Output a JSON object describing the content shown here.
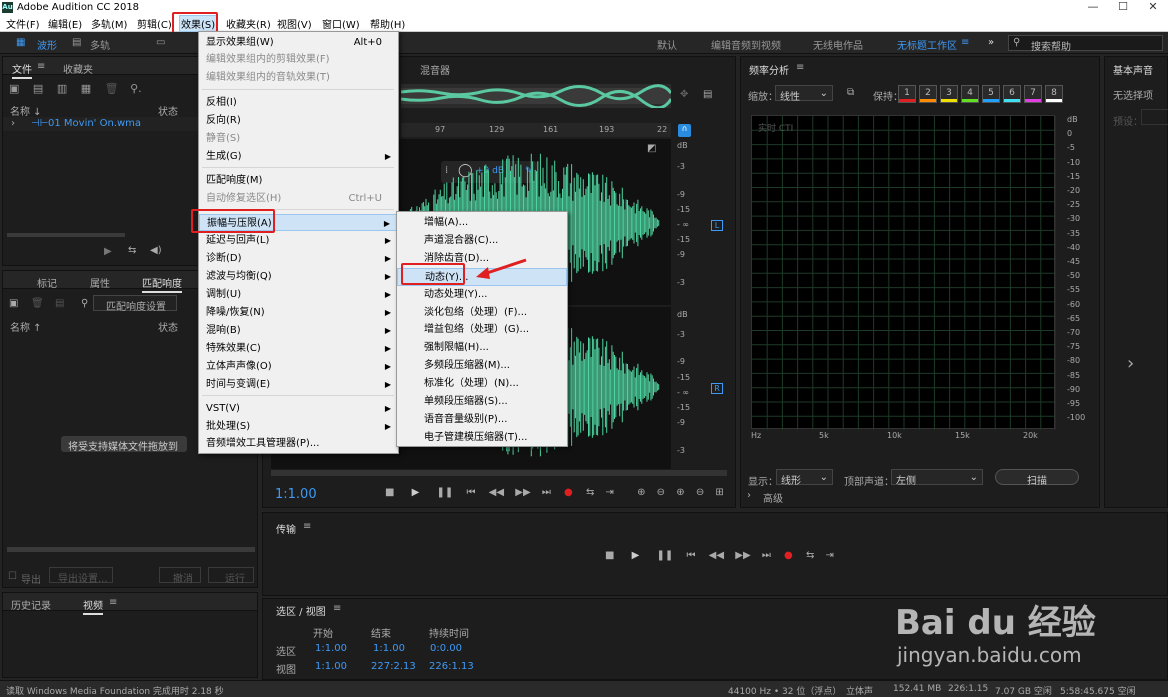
{
  "window": {
    "title": "Adobe Audition CC 2018",
    "logo": "Au"
  },
  "menubar": [
    {
      "label": "文件(F)"
    },
    {
      "label": "编辑(E)"
    },
    {
      "label": "多轨(M)"
    },
    {
      "label": "剪辑(C)"
    },
    {
      "label": "效果(S)"
    },
    {
      "label": "收藏夹(R)"
    },
    {
      "label": "视图(V)"
    },
    {
      "label": "窗口(W)"
    },
    {
      "label": "帮助(H)"
    }
  ],
  "toolbar": {
    "waveform": "波形",
    "multitrack": "多轨",
    "workspaces": [
      "默认",
      "编辑音频到视频",
      "无线电作品",
      "无标题工作区"
    ],
    "more": "»",
    "search_placeholder": "搜索帮助"
  },
  "files_panel": {
    "tabs": [
      "文件",
      "收藏夹"
    ],
    "col_name": "名称 ↓",
    "col_status": "状态",
    "item": "01 Movin' On.wma"
  },
  "markers_panel": {
    "tabs": [
      "标记",
      "属性",
      "匹配响度"
    ],
    "match_settings": "匹配响度设置",
    "col_name": "名称 ↑",
    "col_status": "状态",
    "drop_hint": "将受支持媒体文件拖放到",
    "export": "导出",
    "export_settings": "导出设置...",
    "cancel": "撤消",
    "run": "运行"
  },
  "history_panel": {
    "tabs": [
      "历史记录",
      "视频"
    ]
  },
  "effects_menu": {
    "items": [
      {
        "label": "显示效果组(W)",
        "shortcut": "Alt+0",
        "disabled": false
      },
      {
        "label": "编辑效果组内的剪辑效果(F)",
        "disabled": true
      },
      {
        "label": "编辑效果组内的音轨效果(T)",
        "disabled": true
      },
      {
        "label": "反相(I)",
        "disabled": false
      },
      {
        "label": "反向(R)",
        "disabled": false
      },
      {
        "label": "静音(S)",
        "disabled": true
      },
      {
        "label": "生成(G)",
        "submenu": true
      },
      {
        "label": "匹配响度(M)",
        "disabled": false
      },
      {
        "label": "自动修复选区(H)",
        "shortcut": "Ctrl+U",
        "disabled": true
      },
      {
        "label": "振幅与压限(A)",
        "submenu": true,
        "highlighted": true
      },
      {
        "label": "延迟与回声(L)",
        "submenu": true
      },
      {
        "label": "诊断(D)",
        "submenu": true
      },
      {
        "label": "滤波与均衡(Q)",
        "submenu": true
      },
      {
        "label": "调制(U)",
        "submenu": true
      },
      {
        "label": "降噪/恢复(N)",
        "submenu": true
      },
      {
        "label": "混响(B)",
        "submenu": true
      },
      {
        "label": "特殊效果(C)",
        "submenu": true
      },
      {
        "label": "立体声声像(O)",
        "submenu": true
      },
      {
        "label": "时间与变调(E)",
        "submenu": true
      },
      {
        "label": "VST(V)",
        "submenu": true
      },
      {
        "label": "批处理(S)",
        "submenu": true
      },
      {
        "label": "音频增效工具管理器(P)..."
      }
    ]
  },
  "amplitude_submenu": {
    "items": [
      {
        "label": "增幅(A)..."
      },
      {
        "label": "声道混合器(C)..."
      },
      {
        "label": "消除齿音(D)..."
      },
      {
        "label": "动态(Y)...",
        "highlighted": true
      },
      {
        "label": "动态处理(Y)..."
      },
      {
        "label": "淡化包络（处理）(F)..."
      },
      {
        "label": "增益包络（处理）(G)..."
      },
      {
        "label": "强制限幅(H)..."
      },
      {
        "label": "多频段压缩器(M)..."
      },
      {
        "label": "标准化（处理）(N)..."
      },
      {
        "label": "单频段压缩器(S)..."
      },
      {
        "label": "语音音量级别(P)..."
      },
      {
        "label": "电子管建模压缩器(T)..."
      }
    ]
  },
  "editor": {
    "mixer_tab": "混音器",
    "ruler": [
      "97",
      "129",
      "161",
      "193",
      "22"
    ],
    "hud_db": "+0 dB",
    "db_ticks_top": [
      "dB",
      "-3",
      "-9",
      "-15",
      "- ∞",
      "-15",
      "-9",
      "-3"
    ],
    "db_ticks_bottom": [
      "dB",
      "-3",
      "-9",
      "-15",
      "- ∞",
      "-15",
      "-9",
      "-3"
    ],
    "ch_left": "L",
    "ch_right": "R",
    "time": "1:1.00"
  },
  "freq_panel": {
    "title": "频率分析",
    "scale_label": "缩放：",
    "scale_value": "线性",
    "hold_label": "保持：",
    "hold_slots": [
      "1",
      "2",
      "3",
      "4",
      "5",
      "6",
      "7",
      "8"
    ],
    "hold_colors": [
      "#e02020",
      "#ff8c00",
      "#f0e000",
      "#60e020",
      "#20a0ff",
      "#40e0f0",
      "#e040e0",
      "#ffffff"
    ],
    "cti": "实时 CTI",
    "db_ticks": [
      "dB",
      "0",
      "-5",
      "-10",
      "-15",
      "-20",
      "-25",
      "-30",
      "-35",
      "-40",
      "-45",
      "-50",
      "-55",
      "-60",
      "-65",
      "-70",
      "-75",
      "-80",
      "-85",
      "-90",
      "-95",
      "-100"
    ],
    "x_ticks": [
      "Hz",
      "5k",
      "10k",
      "15k",
      "20k"
    ],
    "display_label": "显示：",
    "display_value": "线形",
    "top_channel_label": "顶部声道：",
    "top_channel_value": "左侧",
    "scan_button": "扫描",
    "advanced": "高级"
  },
  "basic_sound": {
    "title": "基本声音",
    "no_selection": "无选择项",
    "preset": "预设："
  },
  "transport_panel": {
    "title": "传输"
  },
  "selection_panel": {
    "title": "选区 / 视图",
    "cols": [
      "开始",
      "结束",
      "持续时间"
    ],
    "rows": [
      {
        "label": "选区",
        "start": "1:1.00",
        "end": "1:1.00",
        "duration": "0:0.00"
      },
      {
        "label": "视图",
        "start": "1:1.00",
        "end": "227:2.13",
        "duration": "226:1.13"
      }
    ]
  },
  "status": {
    "message": "读取 Windows Media Foundation 完成用时 2.18 秒",
    "samplerate": "44100 Hz • 32 位（浮点）",
    "channels": "立体声",
    "filesize": "152.41 MB",
    "position": "226:1.15",
    "free": "7.07 GB 空闲",
    "time_free": "5:58:45.675 空闲"
  },
  "watermark": {
    "brand": "Bai du 经验",
    "url": "jingyan.baidu.com"
  }
}
